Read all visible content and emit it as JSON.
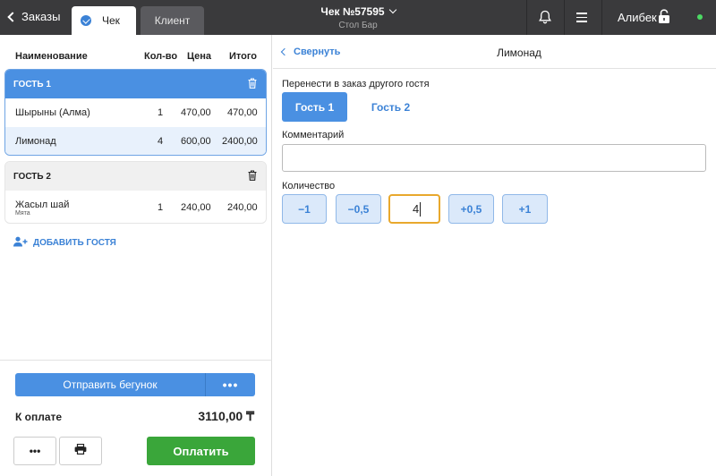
{
  "topbar": {
    "back_label": "Заказы",
    "tab_check": "Чек",
    "tab_client": "Клиент",
    "title": "Чек №57595",
    "subtitle": "Стол Бар",
    "user": "Алибек"
  },
  "order": {
    "columns": {
      "name": "Наименование",
      "qty": "Кол-во",
      "price": "Цена",
      "total": "Итого"
    },
    "guest1": {
      "label": "ГОСТЬ 1",
      "items": [
        {
          "name": "Шырыны (Алма)",
          "qty": "1",
          "price": "470,00",
          "total": "470,00"
        },
        {
          "name": "Лимонад",
          "qty": "4",
          "price": "600,00",
          "total": "2400,00"
        }
      ]
    },
    "guest2": {
      "label": "ГОСТЬ 2",
      "items": [
        {
          "name": "Жасыл шай",
          "modifier": "Мята",
          "qty": "1",
          "price": "240,00",
          "total": "240,00"
        }
      ]
    },
    "add_guest": "ДОБАВИТЬ ГОСТЯ",
    "send_label": "Отправить бегунок",
    "send_more": "•••",
    "total_label": "К оплате",
    "total_value": "3110,00 ₸",
    "more_label": "•••",
    "pay_label": "Оплатить"
  },
  "detail": {
    "collapse_label": "Свернуть",
    "title": "Лимонад",
    "transfer_label": "Перенести в заказ другого гостя",
    "guests": [
      "Гость 1",
      "Гость 2"
    ],
    "comment_label": "Комментарий",
    "comment_value": "",
    "quantity_label": "Количество",
    "quantity_value": "4",
    "qty_buttons": [
      "−1",
      "−0,5",
      "+0,5",
      "+1"
    ]
  },
  "colors": {
    "accent": "#4a90e2",
    "pay": "#3aa63a",
    "topbar": "#3a3a3c",
    "focus": "#e8a82d"
  }
}
